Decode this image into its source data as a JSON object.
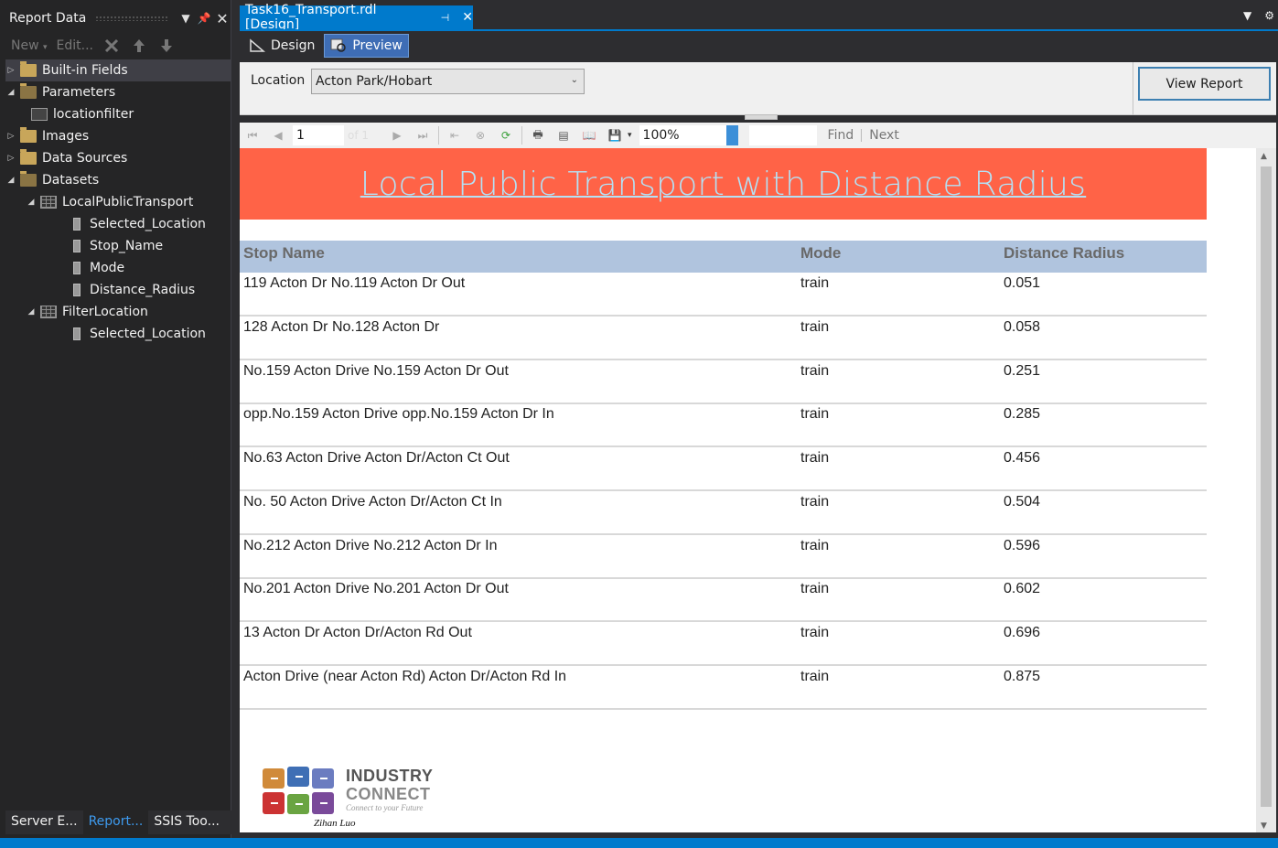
{
  "report_data_panel": {
    "title": "Report Data",
    "toolbar": {
      "new_label": "New",
      "edit_label": "Edit..."
    },
    "tree": [
      {
        "label": "Built-in Fields",
        "type": "folder"
      },
      {
        "label": "Parameters",
        "type": "folder-open"
      },
      {
        "label": "locationfilter",
        "type": "parameter"
      },
      {
        "label": "Images",
        "type": "folder"
      },
      {
        "label": "Data Sources",
        "type": "folder"
      },
      {
        "label": "Datasets",
        "type": "folder-open"
      },
      {
        "label": "LocalPublicTransport",
        "type": "dataset"
      },
      {
        "label": "Selected_Location",
        "type": "field"
      },
      {
        "label": "Stop_Name",
        "type": "field"
      },
      {
        "label": "Mode",
        "type": "field"
      },
      {
        "label": "Distance_Radius",
        "type": "field"
      },
      {
        "label": "FilterLocation",
        "type": "dataset"
      },
      {
        "label": "Selected_Location",
        "type": "field"
      }
    ],
    "bottom_tabs": [
      "Server E...",
      "Report...",
      "SSIS Too..."
    ]
  },
  "document": {
    "tab_title": "Task16_Transport.rdl [Design]",
    "design_label": "Design",
    "preview_label": "Preview"
  },
  "parameters": {
    "location_label": "Location",
    "location_value": "Acton Park/Hobart",
    "view_report_label": "View Report"
  },
  "report_toolbar": {
    "page_number": "1",
    "page_of": "of 1",
    "zoom": "100%",
    "find_label": "Find",
    "next_label": "Next"
  },
  "report": {
    "title": "Local Public Transport with Distance Radius",
    "columns": [
      "Stop Name",
      "Mode",
      "Distance Radius"
    ],
    "rows": [
      [
        "119 Acton Dr No.119 Acton Dr Out",
        "train",
        "0.051"
      ],
      [
        "128 Acton Dr No.128 Acton Dr",
        "train",
        "0.058"
      ],
      [
        "No.159 Acton Drive No.159 Acton Dr Out",
        "train",
        "0.251"
      ],
      [
        "opp.No.159 Acton Drive opp.No.159 Acton Dr In",
        "train",
        "0.285"
      ],
      [
        "No.63 Acton Drive Acton Dr/Acton Ct Out",
        "train",
        "0.456"
      ],
      [
        "No. 50 Acton Drive Acton Dr/Acton Ct In",
        "train",
        "0.504"
      ],
      [
        "No.212 Acton Drive No.212 Acton Dr In",
        "train",
        "0.596"
      ],
      [
        "No.201 Acton Drive No.201 Acton Dr Out",
        "train",
        "0.602"
      ],
      [
        "13 Acton Dr Acton Dr/Acton Rd Out",
        "train",
        "0.696"
      ],
      [
        "Acton Drive (near Acton Rd) Acton Dr/Acton Rd In",
        "train",
        "0.875"
      ]
    ],
    "logo": {
      "line1": "INDUSTRY",
      "line2": "CONNECT",
      "tagline": "Connect to your Future",
      "signature": "Zihan Luo"
    }
  },
  "colors": {
    "banner_bg": "#ff6347",
    "banner_text": "#b4e1f5",
    "header_bg": "#b0c4de",
    "header_text": "#696969",
    "accent": "#007acc"
  }
}
